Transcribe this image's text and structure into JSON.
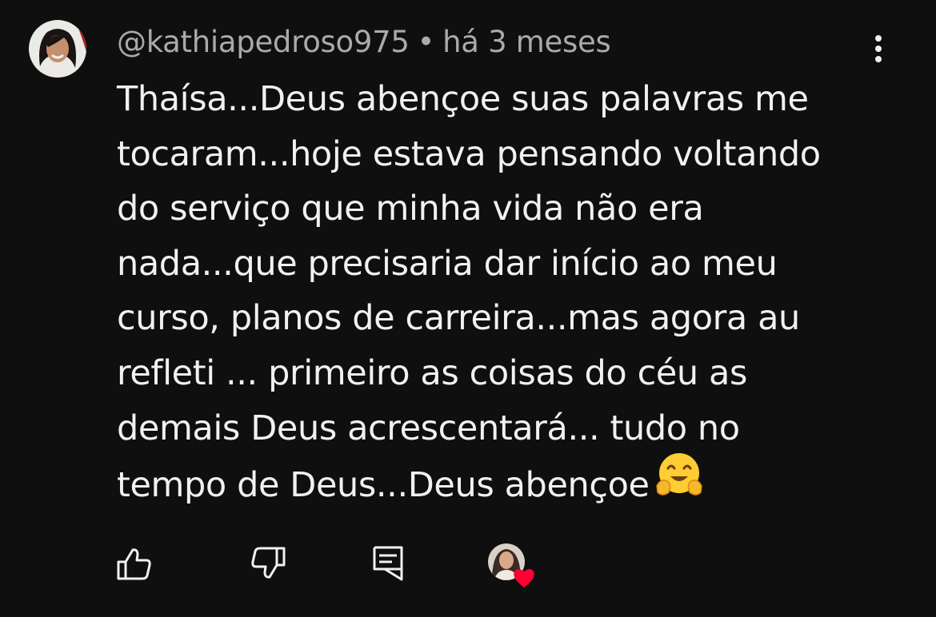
{
  "comment": {
    "author": "@kathiapedroso975",
    "separator": "•",
    "time": "há 3 meses",
    "lines": [
      "Thaísa...Deus abençoe suas palavras me",
      "tocaram...hoje estava pensando voltando",
      "do serviço que minha vida não era",
      "nada...que precisaria dar início ao meu",
      "curso, planos de carreira...mas agora au",
      "refleti ... primeiro as coisas do céu as",
      "demais Deus acrescentará... tudo no",
      "tempo de Deus...Deus abençoe"
    ],
    "emoji": "hugging-face-emoji"
  },
  "actions": {
    "like_icon": "thumbs-up-icon",
    "dislike_icon": "thumbs-down-icon",
    "reply_icon": "reply-comment-icon",
    "creator_heart_icon": "creator-heart-icon"
  },
  "colors": {
    "background": "#0f0f0f",
    "text": "#f1f1f1",
    "meta": "#aaaaaa",
    "heart": "#ff0033"
  }
}
